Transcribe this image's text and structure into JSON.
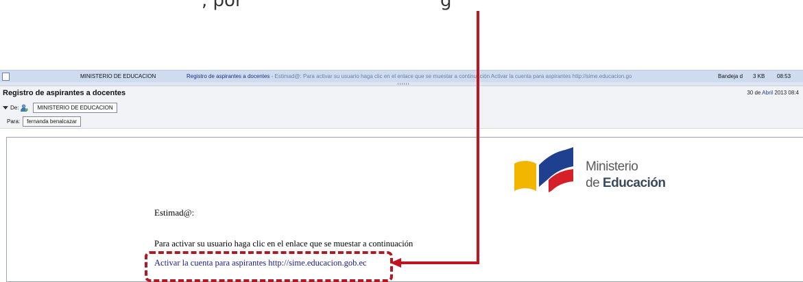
{
  "document_fragment": {
    "text_left": ", por",
    "text_right": "g"
  },
  "list_row": {
    "sender": "MINISTERIO DE EDUCACION",
    "subject": "Registro de aspirantes a docentes",
    "snippet": " - Estimad@: Para activar su usuario haga clic en el enlace que se muestar a continuación Activar la cuenta para aspirantes http://sime.educacion.go",
    "folder": "Bandeja d",
    "size": "3 KB",
    "time": "08:53"
  },
  "message_header": {
    "subject": "Registro de aspirantes a docentes",
    "date_day": "30 de ",
    "date_month": "Abril",
    "date_rest": " 2013 08:4",
    "from_label": "De:",
    "from_value": "MINISTERIO DE EDUCACION",
    "to_label": "Para:",
    "to_value": "fernanda benalcazar"
  },
  "email_body": {
    "logo_line1": "Ministerio",
    "logo_line2_prefix": "de ",
    "logo_line2_bold": "Educación",
    "greeting": "Estimad@:",
    "instruction": "Para activar su usuario haga clic en el enlace que se muestar a continuación",
    "link_text": "Activar la cuenta para aspirantes http://sime.educacion.gob.ec"
  },
  "colors": {
    "annotation": "#c0141f",
    "row_highlight": "#cfdcef",
    "link": "#1a1a8c",
    "logo_yellow": "#f2b600",
    "logo_blue": "#1f3f8f",
    "logo_red": "#d5202a"
  }
}
